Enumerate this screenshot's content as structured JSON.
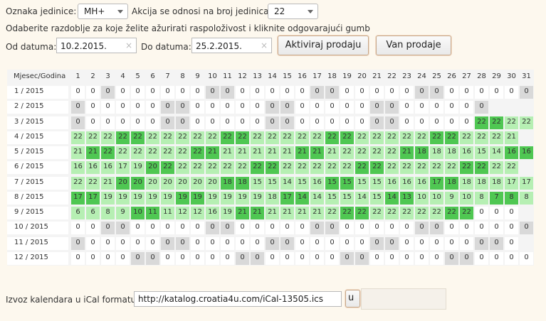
{
  "top": {
    "unit_label": "Oznaka jedinice:",
    "unit_value": "MH+",
    "action_label": "Akcija se odnosi na broj jedinica:",
    "action_value": "22",
    "instruction": "Odaberite razdoblje za koje želite ažurirati raspoloživost i kliknite odgovarajući gumb",
    "from_label": "Od datuma:",
    "from_value": "10.2.2015.",
    "to_label": "Do datuma:",
    "to_value": "25.2.2015.",
    "activate_button": "Aktiviraj prodaju",
    "deactivate_button": "Van prodaje",
    "clear_glyph": "×"
  },
  "calendar": {
    "corner_label": "Mjesec/Godina",
    "days": [
      "1",
      "2",
      "3",
      "4",
      "5",
      "6",
      "7",
      "8",
      "9",
      "10",
      "11",
      "12",
      "13",
      "14",
      "15",
      "16",
      "17",
      "18",
      "19",
      "20",
      "21",
      "22",
      "23",
      "24",
      "25",
      "26",
      "27",
      "28",
      "29",
      "30",
      "31"
    ],
    "months": [
      {
        "label": "1 / 2015",
        "values": [
          "0",
          "0",
          "0",
          "0",
          "0",
          "0",
          "0",
          "0",
          "0",
          "0",
          "0",
          "0",
          "0",
          "0",
          "0",
          "0",
          "0",
          "0",
          "0",
          "0",
          "0",
          "0",
          "0",
          "0",
          "0",
          "0",
          "0",
          "0",
          "0",
          "0",
          "0"
        ],
        "states": [
          "w",
          "w",
          "g",
          "w",
          "w",
          "w",
          "w",
          "w",
          "w",
          "g",
          "g",
          "w",
          "w",
          "w",
          "w",
          "w",
          "g",
          "g",
          "w",
          "w",
          "w",
          "w",
          "w",
          "g",
          "g",
          "w",
          "w",
          "w",
          "w",
          "w",
          "g"
        ]
      },
      {
        "label": "2 / 2015",
        "values": [
          "0",
          "0",
          "0",
          "0",
          "0",
          "0",
          "0",
          "0",
          "0",
          "0",
          "0",
          "0",
          "0",
          "0",
          "0",
          "0",
          "0",
          "0",
          "0",
          "0",
          "0",
          "0",
          "0",
          "0",
          "0",
          "0",
          "0",
          "0"
        ],
        "states": [
          "g",
          "w",
          "w",
          "w",
          "w",
          "w",
          "g",
          "g",
          "w",
          "w",
          "w",
          "w",
          "w",
          "g",
          "g",
          "w",
          "w",
          "w",
          "w",
          "w",
          "g",
          "g",
          "w",
          "w",
          "w",
          "w",
          "w",
          "g"
        ]
      },
      {
        "label": "3 / 2015",
        "values": [
          "0",
          "0",
          "0",
          "0",
          "0",
          "0",
          "0",
          "0",
          "0",
          "0",
          "0",
          "0",
          "0",
          "0",
          "0",
          "0",
          "0",
          "0",
          "0",
          "0",
          "0",
          "0",
          "0",
          "0",
          "0",
          "0",
          "0",
          "22",
          "22",
          "22",
          "22"
        ],
        "states": [
          "g",
          "w",
          "w",
          "w",
          "w",
          "w",
          "g",
          "g",
          "w",
          "w",
          "w",
          "w",
          "w",
          "g",
          "g",
          "w",
          "w",
          "w",
          "w",
          "w",
          "g",
          "g",
          "w",
          "w",
          "w",
          "w",
          "w",
          "D",
          "D",
          "L",
          "L"
        ]
      },
      {
        "label": "4 / 2015",
        "values": [
          "22",
          "22",
          "22",
          "22",
          "22",
          "22",
          "22",
          "22",
          "22",
          "22",
          "22",
          "22",
          "22",
          "22",
          "22",
          "22",
          "22",
          "22",
          "22",
          "22",
          "22",
          "22",
          "22",
          "22",
          "22",
          "22",
          "22",
          "22",
          "22",
          "21"
        ],
        "states": [
          "L",
          "L",
          "L",
          "D",
          "D",
          "L",
          "L",
          "L",
          "L",
          "L",
          "D",
          "D",
          "L",
          "L",
          "L",
          "L",
          "L",
          "D",
          "D",
          "L",
          "L",
          "L",
          "L",
          "L",
          "D",
          "D",
          "L",
          "L",
          "L",
          "L"
        ]
      },
      {
        "label": "5 / 2015",
        "values": [
          "21",
          "21",
          "22",
          "22",
          "22",
          "22",
          "22",
          "22",
          "22",
          "21",
          "21",
          "21",
          "21",
          "21",
          "21",
          "21",
          "21",
          "21",
          "22",
          "22",
          "22",
          "22",
          "21",
          "18",
          "18",
          "18",
          "16",
          "15",
          "14",
          "16",
          "16"
        ],
        "states": [
          "L",
          "D",
          "D",
          "L",
          "L",
          "L",
          "L",
          "L",
          "D",
          "D",
          "L",
          "L",
          "L",
          "L",
          "L",
          "D",
          "D",
          "L",
          "L",
          "L",
          "L",
          "L",
          "D",
          "D",
          "L",
          "L",
          "L",
          "L",
          "L",
          "D",
          "D"
        ]
      },
      {
        "label": "6 / 2015",
        "values": [
          "16",
          "16",
          "16",
          "17",
          "19",
          "20",
          "22",
          "22",
          "22",
          "22",
          "22",
          "22",
          "22",
          "22",
          "22",
          "22",
          "22",
          "22",
          "22",
          "22",
          "22",
          "22",
          "22",
          "22",
          "22",
          "22",
          "22",
          "22",
          "22",
          "22"
        ],
        "states": [
          "L",
          "L",
          "L",
          "L",
          "L",
          "D",
          "D",
          "L",
          "L",
          "L",
          "L",
          "L",
          "D",
          "D",
          "L",
          "L",
          "L",
          "L",
          "L",
          "D",
          "D",
          "L",
          "L",
          "L",
          "L",
          "L",
          "D",
          "D",
          "L",
          "L"
        ]
      },
      {
        "label": "7 / 2015",
        "values": [
          "22",
          "22",
          "21",
          "20",
          "20",
          "20",
          "20",
          "20",
          "20",
          "20",
          "18",
          "18",
          "15",
          "15",
          "14",
          "15",
          "16",
          "15",
          "15",
          "15",
          "15",
          "16",
          "16",
          "16",
          "17",
          "18",
          "18",
          "18",
          "18",
          "17",
          "17"
        ],
        "states": [
          "L",
          "L",
          "L",
          "D",
          "D",
          "L",
          "L",
          "L",
          "L",
          "L",
          "D",
          "D",
          "L",
          "L",
          "L",
          "L",
          "L",
          "D",
          "D",
          "L",
          "L",
          "L",
          "L",
          "L",
          "D",
          "D",
          "L",
          "L",
          "L",
          "L",
          "L"
        ]
      },
      {
        "label": "8 / 2015",
        "values": [
          "17",
          "17",
          "19",
          "19",
          "19",
          "19",
          "19",
          "19",
          "19",
          "19",
          "19",
          "19",
          "19",
          "18",
          "17",
          "14",
          "14",
          "15",
          "15",
          "14",
          "15",
          "14",
          "13",
          "10",
          "10",
          "9",
          "10",
          "8",
          "7",
          "8",
          "8"
        ],
        "states": [
          "D",
          "D",
          "L",
          "L",
          "L",
          "L",
          "L",
          "D",
          "D",
          "L",
          "L",
          "L",
          "L",
          "L",
          "D",
          "D",
          "L",
          "L",
          "L",
          "L",
          "L",
          "D",
          "D",
          "L",
          "L",
          "L",
          "L",
          "L",
          "D",
          "D",
          "L"
        ]
      },
      {
        "label": "9 / 2015",
        "values": [
          "6",
          "6",
          "8",
          "9",
          "10",
          "11",
          "11",
          "12",
          "12",
          "16",
          "19",
          "21",
          "21",
          "21",
          "21",
          "21",
          "21",
          "22",
          "22",
          "22",
          "22",
          "22",
          "22",
          "22",
          "22",
          "22",
          "22",
          "0",
          "0",
          "0"
        ],
        "states": [
          "L",
          "L",
          "L",
          "L",
          "D",
          "D",
          "L",
          "L",
          "L",
          "L",
          "L",
          "D",
          "D",
          "L",
          "L",
          "L",
          "L",
          "L",
          "D",
          "D",
          "L",
          "L",
          "L",
          "L",
          "L",
          "D",
          "D",
          "w",
          "w",
          "w"
        ]
      },
      {
        "label": "10 / 2015",
        "values": [
          "0",
          "0",
          "0",
          "0",
          "0",
          "0",
          "0",
          "0",
          "0",
          "0",
          "0",
          "0",
          "0",
          "0",
          "0",
          "0",
          "0",
          "0",
          "0",
          "0",
          "0",
          "0",
          "0",
          "0",
          "0",
          "0",
          "0",
          "0",
          "0",
          "0",
          "0"
        ],
        "states": [
          "w",
          "w",
          "g",
          "g",
          "w",
          "w",
          "w",
          "w",
          "w",
          "g",
          "g",
          "w",
          "w",
          "w",
          "w",
          "w",
          "g",
          "g",
          "w",
          "w",
          "w",
          "w",
          "w",
          "g",
          "g",
          "w",
          "w",
          "w",
          "w",
          "w",
          "g"
        ]
      },
      {
        "label": "11 / 2015",
        "values": [
          "0",
          "0",
          "0",
          "0",
          "0",
          "0",
          "0",
          "0",
          "0",
          "0",
          "0",
          "0",
          "0",
          "0",
          "0",
          "0",
          "0",
          "0",
          "0",
          "0",
          "0",
          "0",
          "0",
          "0",
          "0",
          "0",
          "0",
          "0",
          "0",
          "0"
        ],
        "states": [
          "g",
          "w",
          "w",
          "w",
          "w",
          "w",
          "g",
          "g",
          "w",
          "w",
          "w",
          "w",
          "w",
          "g",
          "g",
          "w",
          "w",
          "w",
          "w",
          "w",
          "g",
          "g",
          "w",
          "w",
          "w",
          "w",
          "w",
          "g",
          "g",
          "w"
        ]
      },
      {
        "label": "12 / 2015",
        "values": [
          "0",
          "0",
          "0",
          "0",
          "0",
          "0",
          "0",
          "0",
          "0",
          "0",
          "0",
          "0",
          "0",
          "0",
          "0",
          "0",
          "0",
          "0",
          "0",
          "0",
          "0",
          "0",
          "0",
          "0",
          "0",
          "0",
          "0",
          "0",
          "0",
          "0",
          "0"
        ],
        "states": [
          "w",
          "w",
          "w",
          "w",
          "g",
          "g",
          "w",
          "w",
          "w",
          "w",
          "w",
          "g",
          "g",
          "w",
          "w",
          "w",
          "w",
          "w",
          "g",
          "g",
          "w",
          "w",
          "w",
          "w",
          "w",
          "g",
          "g",
          "w",
          "w",
          "w",
          "w"
        ]
      }
    ]
  },
  "export": {
    "label": "Izvoz kalendara u iCal formatu:",
    "url": "http://katalog.croatia4u.com/iCal-13505.ics",
    "button": "u"
  },
  "colors": {
    "page_bg": "#fdf8ee",
    "grid_bg": "#f4f4f4",
    "white": "#ffffff",
    "grey": "#d9d9d9",
    "light_green": "#b6efb3",
    "dark_green": "#4fc752"
  }
}
